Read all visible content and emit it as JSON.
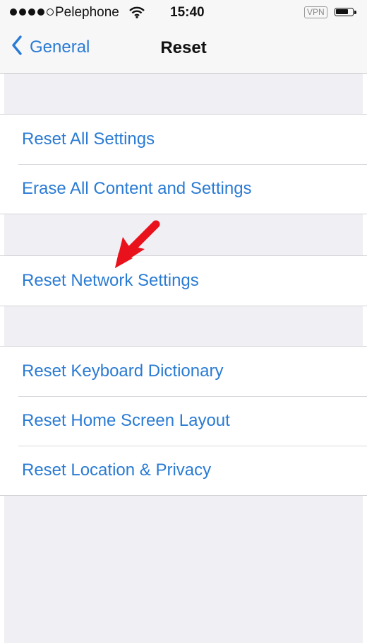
{
  "status_bar": {
    "carrier": "Pelephone",
    "time": "15:40",
    "vpn": "VPN",
    "signal": {
      "filled": 4,
      "total": 5
    }
  },
  "nav": {
    "back_label": "General",
    "title": "Reset"
  },
  "groups": [
    {
      "items": [
        {
          "label": "Reset All Settings"
        },
        {
          "label": "Erase All Content and Settings"
        }
      ]
    },
    {
      "items": [
        {
          "label": "Reset Network Settings"
        }
      ]
    },
    {
      "items": [
        {
          "label": "Reset Keyboard Dictionary"
        },
        {
          "label": "Reset Home Screen Layout"
        },
        {
          "label": "Reset Location & Privacy"
        }
      ]
    }
  ],
  "colors": {
    "accent": "#2a7bd4",
    "background": "#efeff4",
    "annotation_arrow": "#e8111c"
  }
}
